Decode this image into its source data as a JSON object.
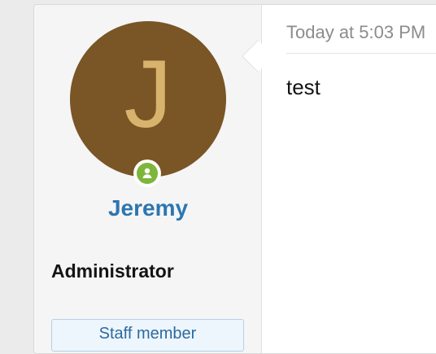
{
  "user": {
    "avatar_letter": "J",
    "name": "Jeremy",
    "title": "Administrator",
    "banner": "Staff member",
    "status_icon": "user-online-icon"
  },
  "message": {
    "date": "Today at 5:03 PM",
    "body": "test"
  },
  "colors": {
    "avatar_background": "#7a5525",
    "avatar_letter": "#d8b36e",
    "username": "#2d76b0",
    "status_online": "#7db63a",
    "banner_background": "#edf6fd",
    "banner_border": "#b7d0e6"
  }
}
